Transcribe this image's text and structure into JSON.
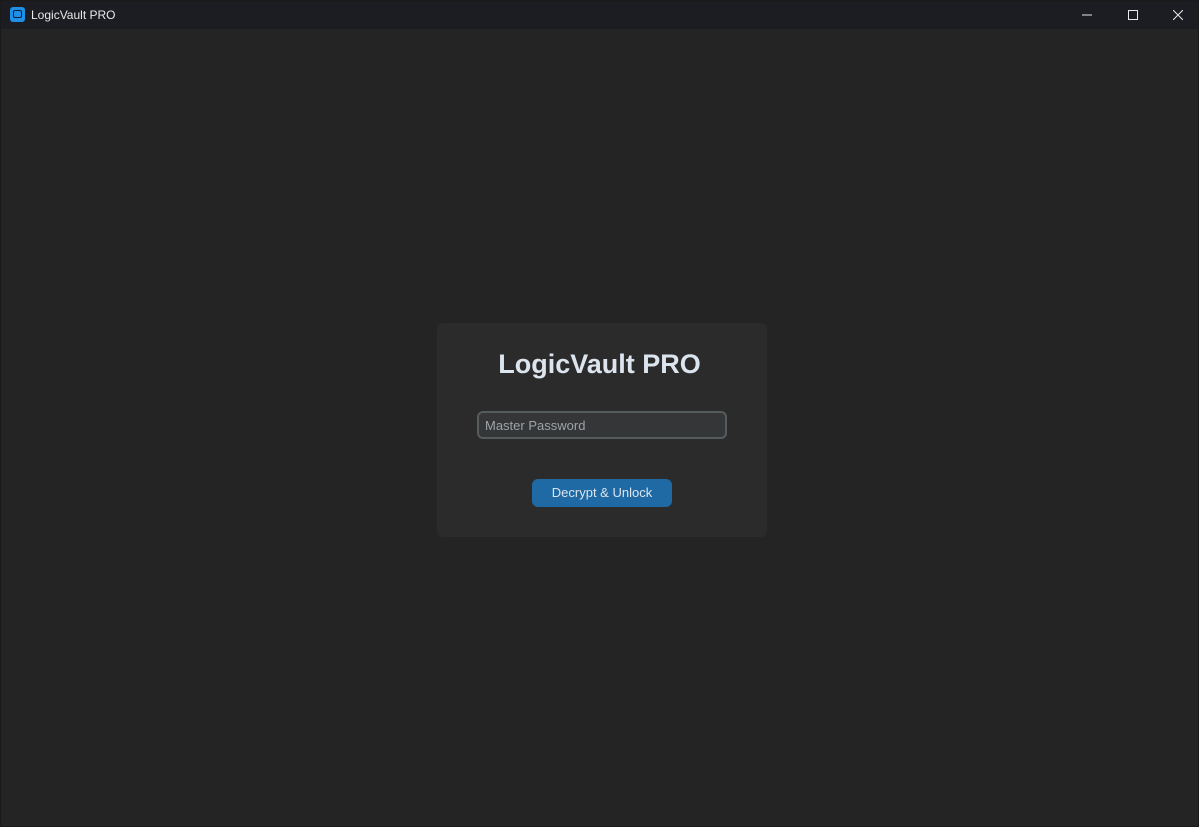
{
  "window": {
    "title": "LogicVault PRO",
    "app_icon": "app-icon",
    "controls": {
      "minimize_icon": "minimize-icon",
      "maximize_icon": "maximize-icon",
      "close_icon": "close-icon"
    }
  },
  "login": {
    "heading": "LogicVault PRO",
    "password_placeholder": "Master Password",
    "password_value": "",
    "unlock_label": "Decrypt & Unlock"
  },
  "colors": {
    "background": "#242424",
    "titlebar": "#1b1d23",
    "card": "#2b2b2b",
    "accent": "#1f6aa5",
    "app_icon": "#1e90e8"
  }
}
